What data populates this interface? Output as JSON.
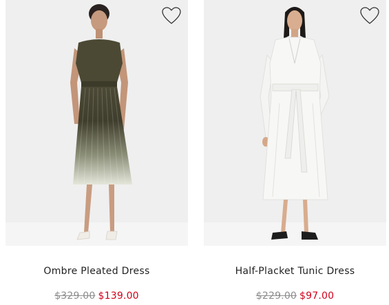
{
  "products": [
    {
      "name": "Ombre Pleated Dress",
      "original_price": "$329.00",
      "sale_price": "$139.00",
      "favorite_icon": "heart-outline-icon",
      "image": "model-wearing-olive-ombre-pleated-dress"
    },
    {
      "name": "Half-Placket Tunic Dress",
      "original_price": "$229.00",
      "sale_price": "$97.00",
      "favorite_icon": "heart-outline-icon",
      "image": "model-wearing-white-tunic-dress"
    }
  ],
  "colors": {
    "sale_price": "#d0021b",
    "original_price": "#8c8c8c",
    "product_name": "#222222",
    "image_background": "#efefef"
  }
}
